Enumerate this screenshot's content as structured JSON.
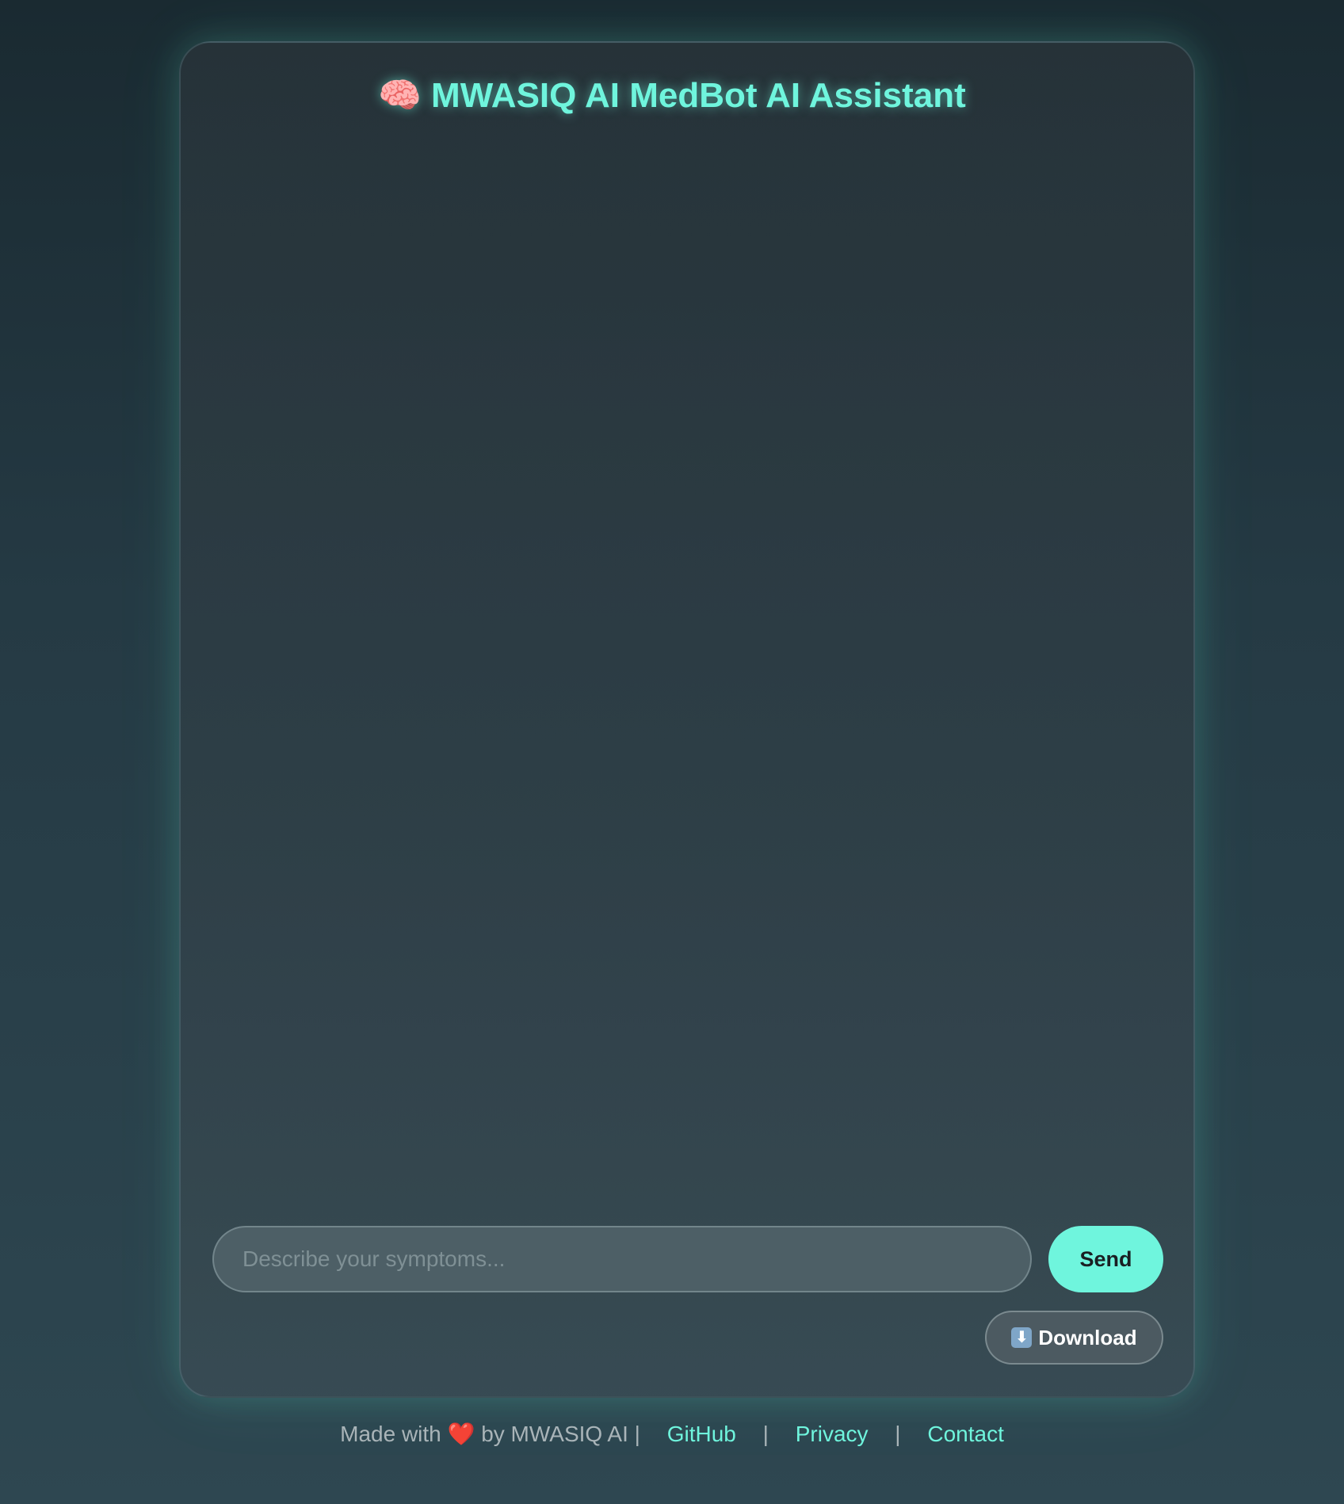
{
  "header": {
    "icon": "brain-icon",
    "icon_glyph": "🧠",
    "title": "MWASIQ AI MedBot AI Assistant"
  },
  "chat": {
    "messages": []
  },
  "composer": {
    "placeholder": "Describe your symptoms...",
    "value": "",
    "send_label": "Send",
    "download_icon": "down-arrow-icon",
    "download_icon_glyph": "⬇",
    "download_label": "Download"
  },
  "footer": {
    "made_with_prefix": "Made with",
    "heart_glyph": "❤️",
    "made_with_suffix": "by MWASIQ AI",
    "separator": "|",
    "links": [
      {
        "label": "GitHub"
      },
      {
        "label": "Privacy"
      },
      {
        "label": "Contact"
      }
    ]
  },
  "colors": {
    "accent": "#6ff5dd",
    "background": "#253a44"
  }
}
